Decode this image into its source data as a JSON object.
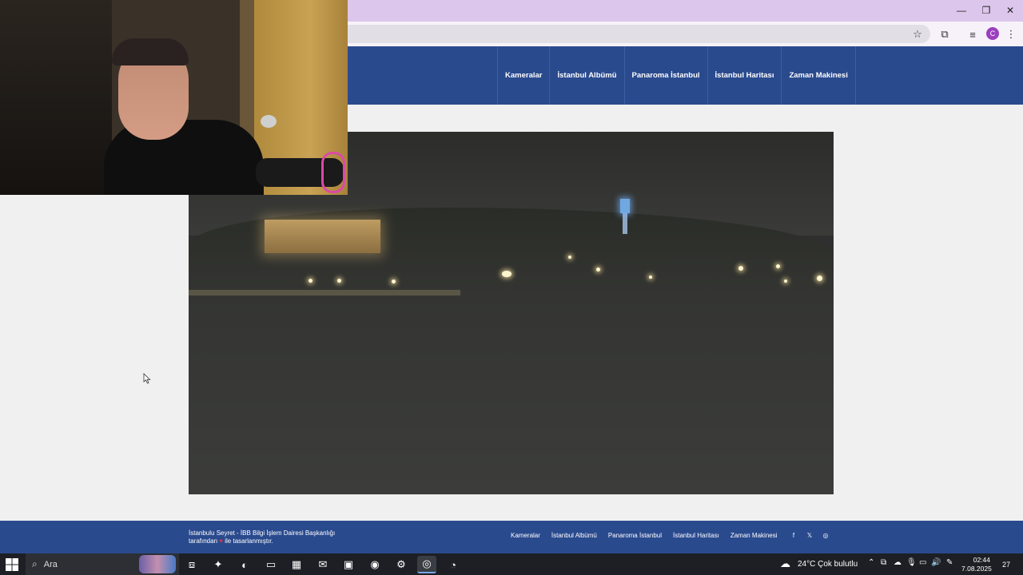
{
  "browser": {
    "window_controls": {
      "minimize": "—",
      "restore": "❐",
      "close": "✕"
    },
    "toolbar_icons": [
      "star-icon",
      "extensions-icon",
      "media-icon",
      "profile-avatar",
      "menu-icon"
    ],
    "profile_initial": "C"
  },
  "site": {
    "nav": [
      "Kameralar",
      "İstanbul Albümü",
      "Panaroma İstanbul",
      "İstanbul Haritası",
      "Zaman Makinesi"
    ],
    "footer": {
      "line1": "İstanbulu Seyret - İBB Bilgi İşlem Dairesi Başkanlığı",
      "line2_prefix": "tarafından",
      "line2_suffix": "ile tasarlanmıştır.",
      "heart": "♥",
      "nav": [
        "Kameralar",
        "İstanbul Albümü",
        "Panaroma İstanbul",
        "İstanbul Haritası",
        "Zaman Makinesi"
      ],
      "social": {
        "facebook": "f",
        "x": "𝕏",
        "instagram": "◎"
      }
    }
  },
  "taskbar": {
    "search_label": "Ara",
    "weather": "24°C  Çok bulutlu",
    "time": "02:44",
    "date": "7.08.2025",
    "notifications": "27",
    "colors": {
      "accent": "#2a4a8e",
      "titlebar": "#dcc6ec"
    }
  }
}
